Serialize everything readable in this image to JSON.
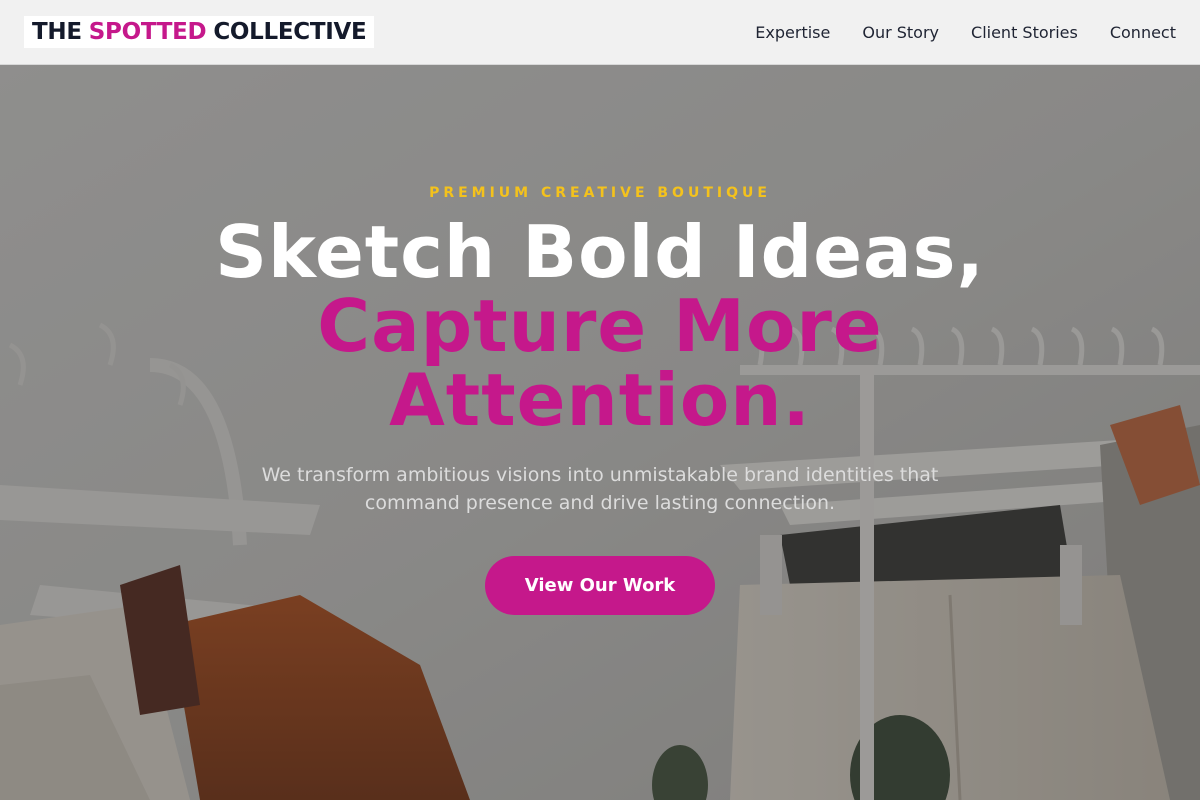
{
  "brand": {
    "word1": "THE",
    "word2": "SPOTTED",
    "word3": "COLLECTIVE",
    "accent_color": "#c5188b",
    "dark_color": "#141a2b"
  },
  "nav": {
    "items": [
      {
        "label": "Expertise"
      },
      {
        "label": "Our Story"
      },
      {
        "label": "Client Stories"
      },
      {
        "label": "Connect"
      }
    ]
  },
  "hero": {
    "eyebrow": "PREMIUM CREATIVE BOUTIQUE",
    "eyebrow_color": "#f4c21c",
    "title_line1": "Sketch Bold Ideas,",
    "title_line2": "Capture More",
    "title_line3": "Attention.",
    "subtitle": "We transform ambitious visions into unmistakable brand identities that command presence and drive lasting connection.",
    "cta_label": "View Our Work",
    "background": "clothing racks with hangers and garments"
  }
}
